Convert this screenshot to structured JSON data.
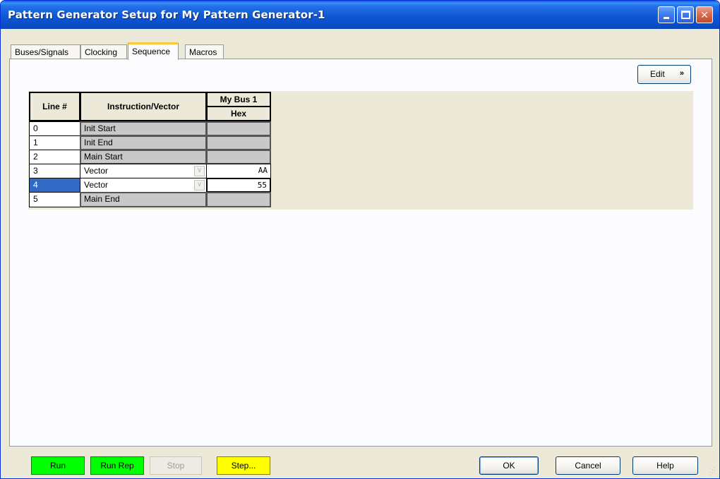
{
  "window": {
    "title": "Pattern Generator Setup for My Pattern Generator-1"
  },
  "tabs": [
    {
      "label": "Buses/Signals",
      "active": false
    },
    {
      "label": "Clocking",
      "active": false
    },
    {
      "label": "Sequence",
      "active": true
    },
    {
      "label": "Macros",
      "active": false
    }
  ],
  "edit_menu": {
    "label": "Edit",
    "icon": "double-chevron-down-icon"
  },
  "grid": {
    "headers": {
      "line": "Line #",
      "instruction": "Instruction/Vector",
      "bus_name": "My Bus 1",
      "bus_radix": "Hex"
    },
    "rows": [
      {
        "line": "0",
        "instruction": "Init Start",
        "value": "",
        "editable": false,
        "selected": false
      },
      {
        "line": "1",
        "instruction": "Init End",
        "value": "",
        "editable": false,
        "selected": false
      },
      {
        "line": "2",
        "instruction": "Main Start",
        "value": "",
        "editable": false,
        "selected": false
      },
      {
        "line": "3",
        "instruction": "Vector",
        "value": "AA",
        "editable": true,
        "selected": false
      },
      {
        "line": "4",
        "instruction": "Vector",
        "value": "55",
        "editable": true,
        "selected": true
      },
      {
        "line": "5",
        "instruction": "Main End",
        "value": "",
        "editable": false,
        "selected": false
      }
    ]
  },
  "footer": {
    "run": "Run",
    "run_rep": "Run Rep",
    "stop": "Stop",
    "step": "Step...",
    "ok": "OK",
    "cancel": "Cancel",
    "help": "Help"
  },
  "colors": {
    "titlebar": "#0b4fc8",
    "run_green": "#00ff00",
    "step_yellow": "#ffff00",
    "selection_blue": "#316ac5",
    "active_tab_accent": "#ffc73c"
  }
}
